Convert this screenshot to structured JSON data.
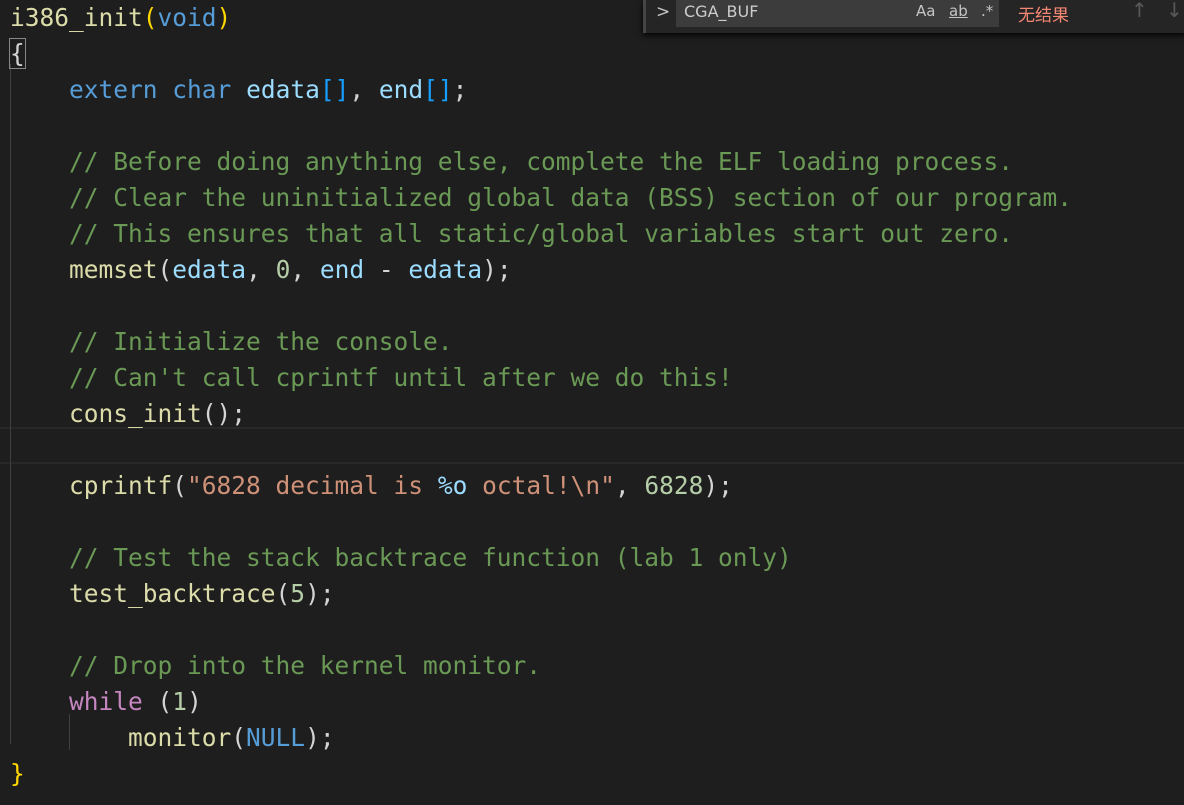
{
  "find_widget": {
    "query": "CGA_BUF",
    "match_case": "Aa",
    "whole_word": "ab",
    "regex": ".*",
    "result": "无结果",
    "prev_icon": "arrow-up-icon",
    "next_icon": "arrow-down-icon",
    "toggle_icon": "chevron-right-icon"
  },
  "code": [
    [
      [
        "i386_init",
        "fn"
      ],
      [
        "(",
        "b1"
      ],
      [
        "void",
        "kw"
      ],
      [
        ")",
        "b1"
      ]
    ],
    [
      [
        "{",
        "p"
      ]
    ],
    [
      [
        "    ",
        ""
      ],
      [
        "extern",
        "kw"
      ],
      [
        " ",
        ""
      ],
      [
        "char",
        "kw"
      ],
      [
        " ",
        ""
      ],
      [
        "edata",
        "var"
      ],
      [
        "[]",
        "b3"
      ],
      [
        ", ",
        "p"
      ],
      [
        "end",
        "var"
      ],
      [
        "[]",
        "b3"
      ],
      [
        ";",
        "p"
      ]
    ],
    [],
    [
      [
        "    // Before doing anything else, complete the ELF loading process.",
        "cm"
      ]
    ],
    [
      [
        "    // Clear the uninitialized global data (BSS) section of our program.",
        "cm"
      ]
    ],
    [
      [
        "    // This ensures that all static/global variables start out zero.",
        "cm"
      ]
    ],
    [
      [
        "    ",
        ""
      ],
      [
        "memset",
        "fn"
      ],
      [
        "(",
        "p"
      ],
      [
        "edata",
        "var"
      ],
      [
        ", ",
        "p"
      ],
      [
        "0",
        "num"
      ],
      [
        ", ",
        "p"
      ],
      [
        "end",
        "var"
      ],
      [
        " - ",
        "p"
      ],
      [
        "edata",
        "var"
      ],
      [
        ");",
        "p"
      ]
    ],
    [],
    [
      [
        "    // Initialize the console.",
        "cm"
      ]
    ],
    [
      [
        "    // Can't call cprintf until after we do this!",
        "cm"
      ]
    ],
    [
      [
        "    ",
        ""
      ],
      [
        "cons_init",
        "fn"
      ],
      [
        "();",
        "p"
      ]
    ],
    [],
    [
      [
        "    ",
        ""
      ],
      [
        "cprintf",
        "fn"
      ],
      [
        "(",
        "p"
      ],
      [
        "\"6828 decimal is ",
        "str"
      ],
      [
        "%o",
        "fmt"
      ],
      [
        " octal!\\n\"",
        "str"
      ],
      [
        ", ",
        "p"
      ],
      [
        "6828",
        "num"
      ],
      [
        ");",
        "p"
      ]
    ],
    [],
    [
      [
        "    // Test the stack backtrace function (lab 1 only)",
        "cm"
      ]
    ],
    [
      [
        "    ",
        ""
      ],
      [
        "test_backtrace",
        "fn"
      ],
      [
        "(",
        "p"
      ],
      [
        "5",
        "num"
      ],
      [
        ");",
        "p"
      ]
    ],
    [],
    [
      [
        "    // Drop into the kernel monitor.",
        "cm"
      ]
    ],
    [
      [
        "    ",
        ""
      ],
      [
        "while",
        "ctl"
      ],
      [
        " (",
        "p"
      ],
      [
        "1",
        "num"
      ],
      [
        ")",
        "p"
      ]
    ],
    [
      [
        "        ",
        ""
      ],
      [
        "monitor",
        "fn"
      ],
      [
        "(",
        "p"
      ],
      [
        "NULL",
        "const"
      ],
      [
        ");",
        "p"
      ]
    ],
    [
      [
        "}",
        "b1"
      ]
    ]
  ]
}
